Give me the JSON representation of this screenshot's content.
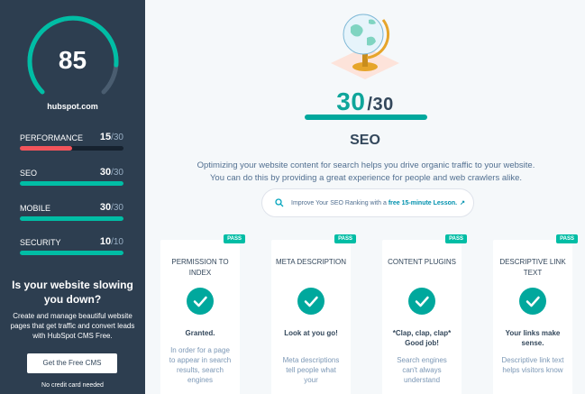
{
  "sidebar": {
    "overall_score": "85",
    "overall_score_fraction": 0.85,
    "domain": "hubspot.com",
    "metrics": [
      {
        "label": "PERFORMANCE",
        "score": "15",
        "total": "/30",
        "fraction": 0.5,
        "color": "#f2545b"
      },
      {
        "label": "SEO",
        "score": "30",
        "total": "/30",
        "fraction": 1.0,
        "color": "#00bda5"
      },
      {
        "label": "MOBILE",
        "score": "30",
        "total": "/30",
        "fraction": 1.0,
        "color": "#00bda5"
      },
      {
        "label": "SECURITY",
        "score": "10",
        "total": "/10",
        "fraction": 1.0,
        "color": "#00bda5"
      }
    ],
    "promo_title": "Is your website slowing you down?",
    "promo_text": "Create and manage beautiful website pages that get traffic and convert leads with HubSpot CMS Free.",
    "cta_label": "Get the Free CMS",
    "cta_note": "No credit card needed"
  },
  "main": {
    "icon": "globe-icon",
    "score": "30",
    "score_total": "/30",
    "score_fraction": 1.0,
    "title": "SEO",
    "description": "Optimizing your website content for search helps you drive organic traffic to your website. You can do this by providing a great experience for people and web crawlers alike.",
    "improve_text": "Improve Your SEO Ranking with a",
    "improve_link": "free 15-minute Lesson.",
    "cards": [
      {
        "badge": "PASS",
        "title": "PERMISSION TO INDEX",
        "result": "Granted.",
        "detail": "In order for a page to appear in search results, search engines"
      },
      {
        "badge": "PASS",
        "title": "META DESCRIPTION",
        "result": "Look at you go!",
        "detail": "Meta descriptions tell people what your"
      },
      {
        "badge": "PASS",
        "title": "CONTENT PLUGINS",
        "result": "*Clap, clap, clap* Good job!",
        "detail": "Search engines can't always understand"
      },
      {
        "badge": "PASS",
        "title": "DESCRIPTIVE LINK TEXT",
        "result": "Your links make sense.",
        "detail": "Descriptive link text helps visitors know"
      }
    ]
  },
  "colors": {
    "sidebar_bg": "#2d3e50",
    "accent_teal": "#00bda5",
    "performance_red": "#f2545b",
    "page_bg": "#f5f8fa"
  }
}
